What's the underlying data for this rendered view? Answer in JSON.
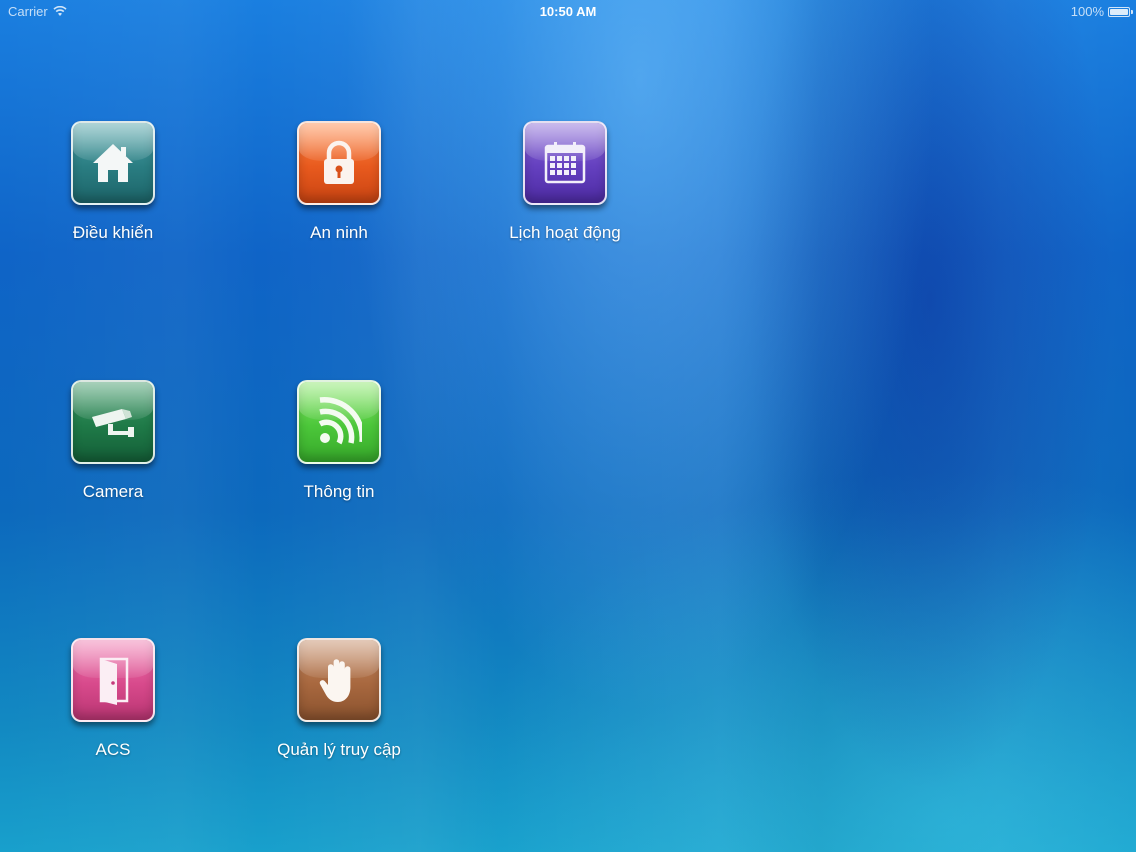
{
  "status_bar": {
    "carrier": "Carrier",
    "wifi_icon": "wifi-icon",
    "time": "10:50 AM",
    "battery_percent": "100%",
    "battery_level": 1.0
  },
  "apps": [
    {
      "label": "Điều khiển",
      "icon": "home-icon",
      "color": "#2a7d82"
    },
    {
      "label": "An ninh",
      "icon": "lock-icon",
      "color": "#e85a1e"
    },
    {
      "label": "Lịch hoạt động",
      "icon": "calendar-icon",
      "color": "#6440bf"
    },
    {
      "label": "Camera",
      "icon": "security-camera-icon",
      "color": "#1f7a48"
    },
    {
      "label": "Thông tin",
      "icon": "rss-feed-icon",
      "color": "#4cc73a"
    },
    {
      "label": "ACS",
      "icon": "door-icon",
      "color": "#d84a8c"
    },
    {
      "label": "Quản lý truy cập",
      "icon": "hand-stop-icon",
      "color": "#a8683f"
    }
  ]
}
